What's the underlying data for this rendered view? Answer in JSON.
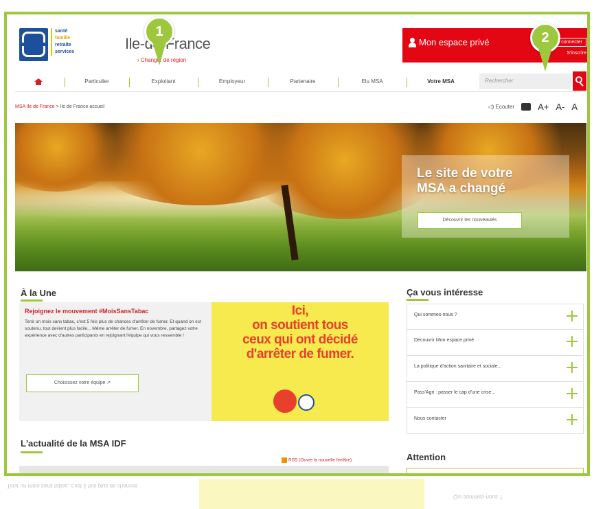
{
  "header": {
    "tagline": [
      "santé",
      "famille",
      "retraite",
      "services"
    ],
    "region_title": "Ile-de-France",
    "region_link": "› Changer de région",
    "espace": {
      "label": "Mon espace privé",
      "connect": "Se connecter",
      "register": "S'inscrire"
    },
    "badges": [
      "1",
      "2"
    ]
  },
  "nav": {
    "items": [
      "Particulier",
      "Exploitant",
      "Employeur",
      "Partenaire",
      "Elu MSA",
      "Votre MSA"
    ],
    "search_placeholder": "Rechercher"
  },
  "breadcrumb": {
    "root": "MSA Ile de France",
    "separator": ">",
    "current": "Ile de France accueil"
  },
  "tools": {
    "listen": "Ecouter",
    "font_bigger": "A+",
    "font_smaller": "A-",
    "font_reset": "A"
  },
  "hero": {
    "title_line1": "Le site de votre",
    "title_line2": "MSA a changé",
    "cta": "Découvrir les nouveautés"
  },
  "une": {
    "heading": "À la Une",
    "title": "Rejoignez le mouvement #MoisSansTabac",
    "text": "Tenir un mois sans tabac, c'est 5 fois plus de chances d'arrêter de fumer. Et quand on est soutenu, tout devient plus facile... Même arrêter de fumer. En novembre, partagez votre expérience avec d'autres participants en rejoignant l'équipe qui vous ressemble !",
    "button": "Choisissez votre équipe",
    "image_text": [
      "Ici,",
      "on soutient tous",
      "ceux qui ont décidé",
      "d'arrêter de fumer."
    ]
  },
  "interesse": {
    "heading": "Ça vous intéresse",
    "items": [
      "Qui sommes-nous ?",
      "Découvrir Mon espace privé",
      "La politique d'action sanitaire et sociale...",
      "Pass'Agri : passer le cap d'une crise...",
      "Nous contacter"
    ]
  },
  "actualite": {
    "heading": "L'actualité de la MSA IDF",
    "rss": "RSS (Ouvre la nouvelle fenêtre)"
  },
  "attention": {
    "heading": "Attention"
  },
  "reflection": {
    "left": "Tenir un mois sans tabac, c'est 5 fois plus de chances",
    "right": "Qui sommes-nous ?"
  }
}
